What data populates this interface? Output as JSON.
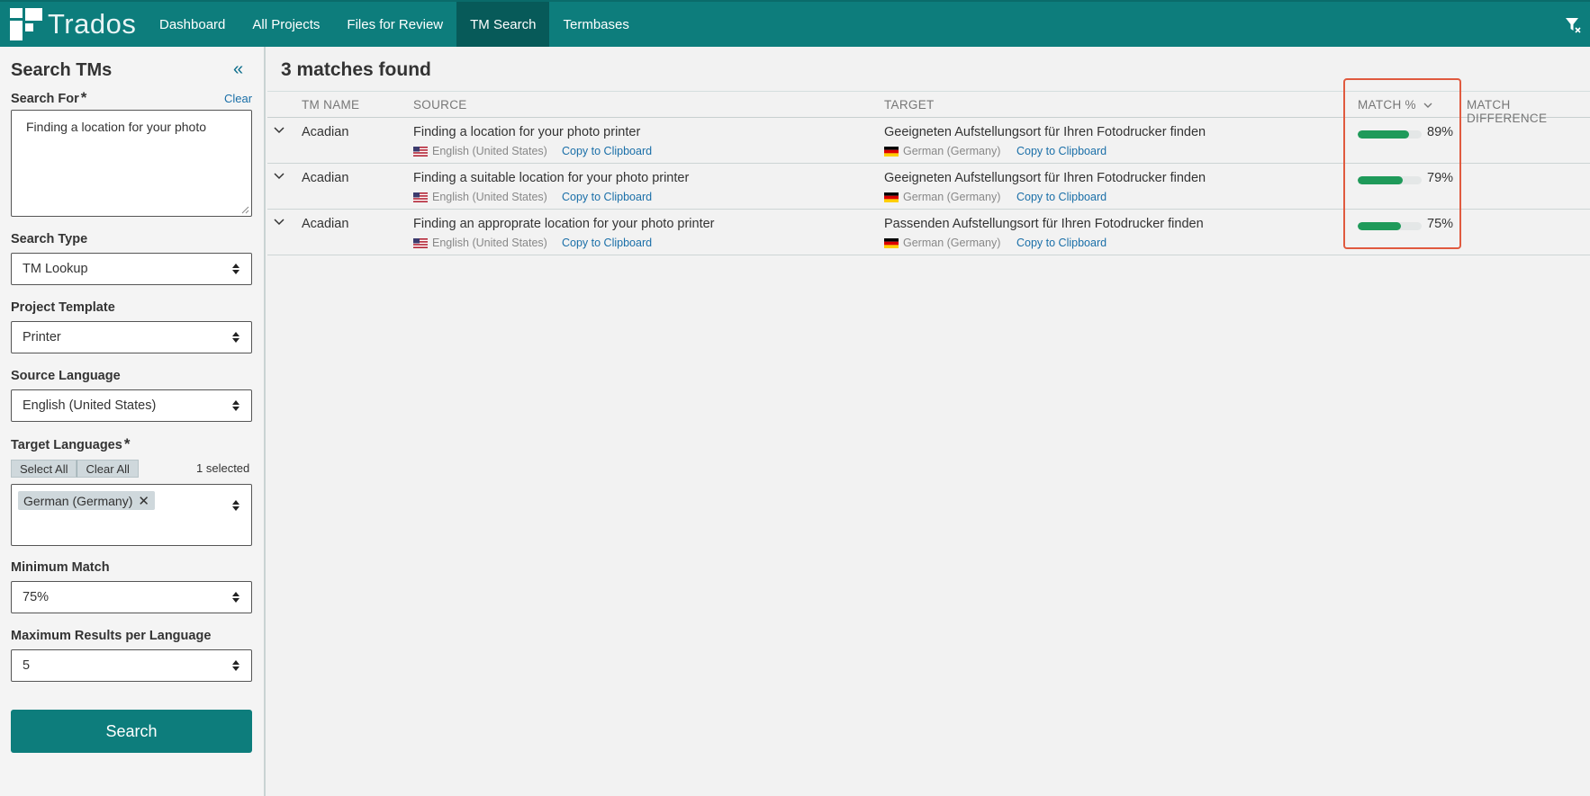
{
  "app": {
    "name": "Trados"
  },
  "nav": {
    "items": [
      {
        "label": "Dashboard"
      },
      {
        "label": "All Projects"
      },
      {
        "label": "Files for Review"
      },
      {
        "label": "TM Search"
      },
      {
        "label": "Termbases"
      }
    ],
    "active": "TM Search"
  },
  "sidebar": {
    "title": "Search TMs",
    "search_for": {
      "label": "Search For",
      "required": "*",
      "clear": "Clear",
      "value": "Finding a location for your photo"
    },
    "search_type": {
      "label": "Search Type",
      "value": "TM Lookup"
    },
    "project_template": {
      "label": "Project Template",
      "value": "Printer"
    },
    "source_language": {
      "label": "Source Language",
      "value": "English (United States)"
    },
    "target_languages": {
      "label": "Target Languages",
      "required": "*",
      "select_all": "Select All",
      "clear_all": "Clear All",
      "selected_count": "1 selected",
      "chips": [
        "German (Germany)"
      ]
    },
    "minimum_match": {
      "label": "Minimum Match",
      "value": "75%"
    },
    "max_results": {
      "label": "Maximum Results per Language",
      "value": "5"
    },
    "search_button": "Search"
  },
  "main": {
    "title": "3 matches found",
    "columns": {
      "tm_name": "TM NAME",
      "source": "SOURCE",
      "target": "TARGET",
      "match": "MATCH %",
      "match_diff": "MATCH DIFFERENCE"
    },
    "copy_label": "Copy to Clipboard",
    "rows": [
      {
        "tm": "Acadian",
        "source": "Finding a location for your photo printer",
        "source_lang": "English (United States)",
        "target": "Geeigneten Aufstellungsort für Ihren Fotodrucker finden",
        "target_lang": "German (Germany)",
        "match": "89%",
        "match_value": 89
      },
      {
        "tm": "Acadian",
        "source": "Finding a suitable location for your photo printer",
        "source_lang": "English (United States)",
        "target": "Geeigneten Aufstellungsort für Ihren Fotodrucker finden",
        "target_lang": "German (Germany)",
        "match": "79%",
        "match_value": 79
      },
      {
        "tm": "Acadian",
        "source": "Finding an approprate location for your photo printer",
        "source_lang": "English (United States)",
        "target": "Passenden Aufstellungsort für Ihren Fotodrucker finden",
        "target_lang": "German (Germany)",
        "match": "75%",
        "match_value": 75
      }
    ]
  },
  "colors": {
    "brand": "#0d7d7c",
    "nav_active": "#075a59",
    "match_bar": "#1f9a5a",
    "link": "#1a6fa8",
    "highlight": "#e05a3f"
  }
}
